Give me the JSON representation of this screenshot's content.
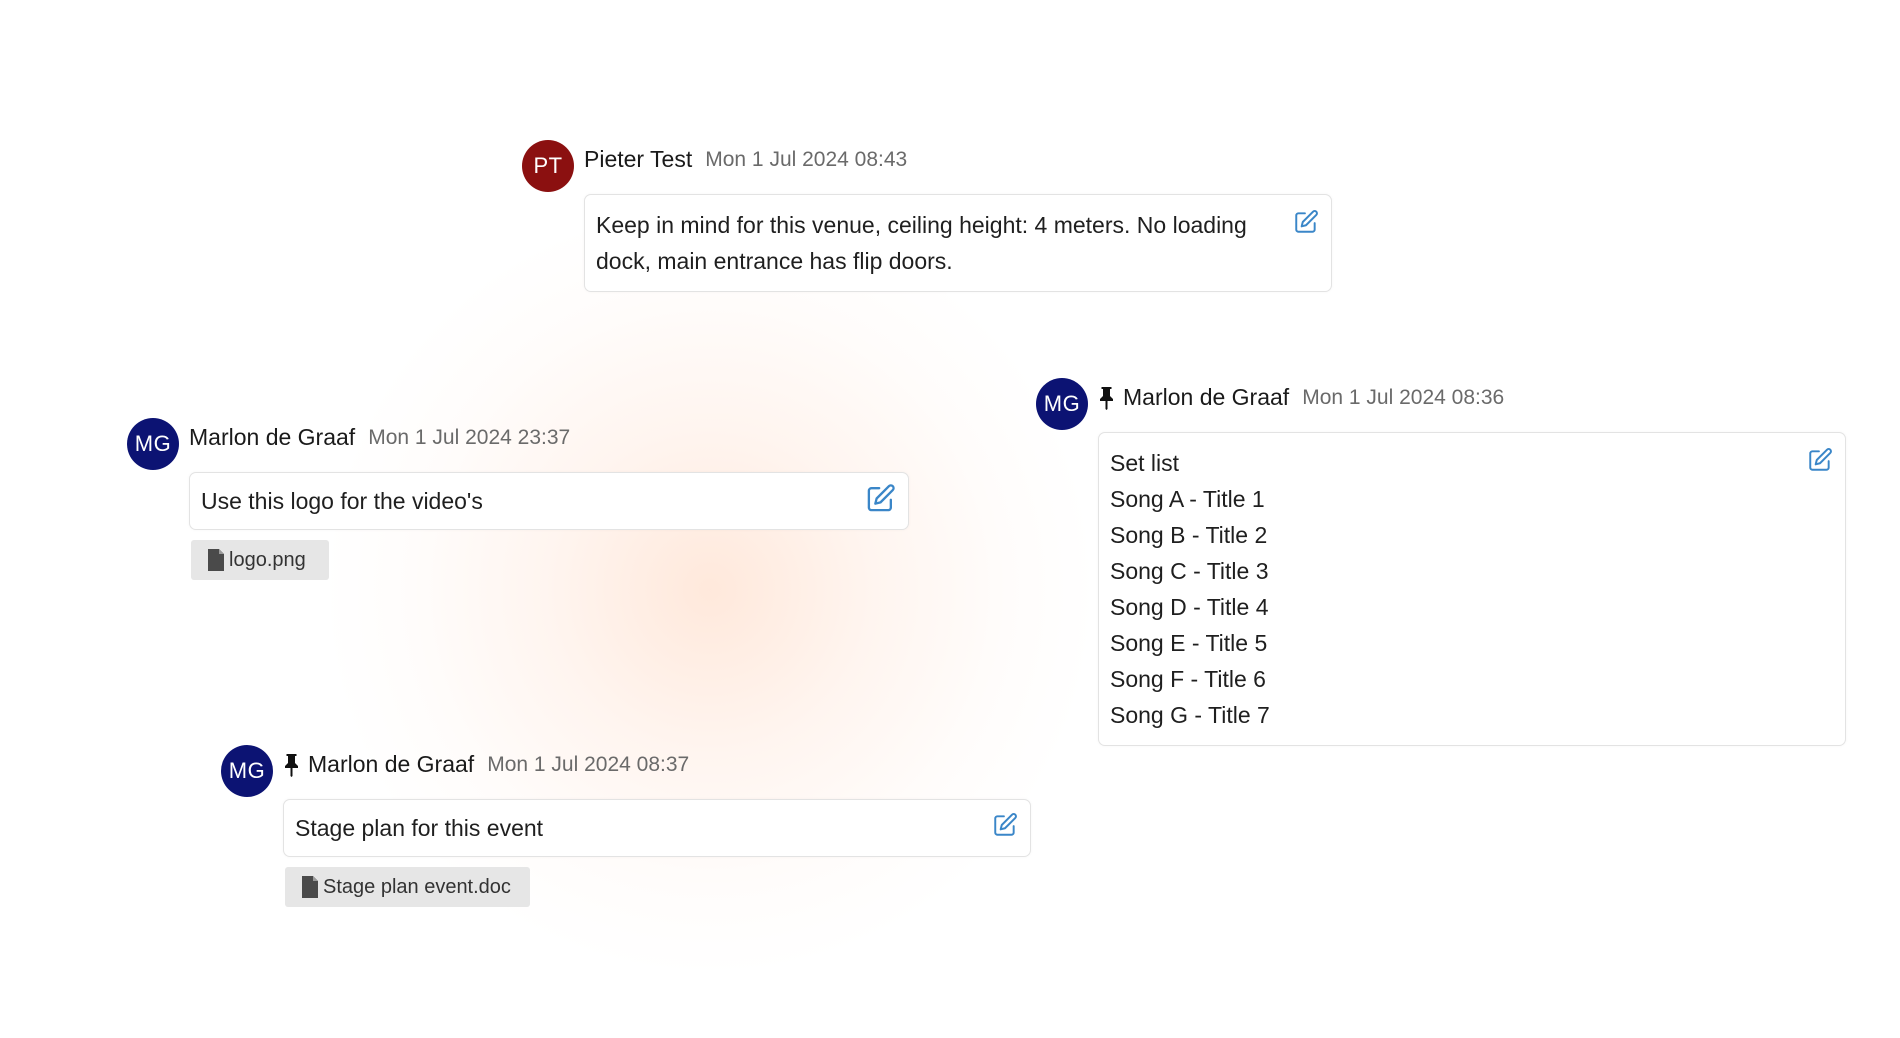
{
  "notes": [
    {
      "initials": "PT",
      "avatar_color": "#8b1010",
      "author": "Pieter Test",
      "timestamp": "Mon 1 Jul 2024 08:43",
      "pinned": false,
      "lines": [
        "Keep in mind for this venue, ceiling height: 4 meters. No loading",
        "dock, main entrance has flip doors."
      ],
      "attachment": null
    },
    {
      "initials": "MG",
      "avatar_color": "#0c1373",
      "author": "Marlon de Graaf",
      "timestamp": "Mon 1 Jul 2024 08:36",
      "pinned": true,
      "lines": [
        "Set list",
        "Song A - Title 1",
        "Song B - Title 2",
        "Song C - Title 3",
        "Song D - Title 4",
        "Song E - Title 5",
        "Song F - Title 6",
        "Song G - Title 7"
      ],
      "attachment": null
    },
    {
      "initials": "MG",
      "avatar_color": "#0c1373",
      "author": "Marlon de Graaf",
      "timestamp": "Mon 1 Jul 2024 23:37",
      "pinned": false,
      "lines": [
        "Use this logo for the video's"
      ],
      "attachment": "logo.png"
    },
    {
      "initials": "MG",
      "avatar_color": "#0c1373",
      "author": "Marlon de Graaf",
      "timestamp": "Mon 1 Jul 2024 08:37",
      "pinned": true,
      "lines": [
        "Stage plan for this event"
      ],
      "attachment": "Stage plan event.doc"
    }
  ],
  "icons": {
    "edit": "edit-icon",
    "pin": "pin-icon",
    "file": "file-icon"
  },
  "colors": {
    "accent_icon": "#3a86c8",
    "avatar_red": "#8b1010",
    "avatar_navy": "#0c1373",
    "attachment_bg": "#e6e6e6"
  }
}
